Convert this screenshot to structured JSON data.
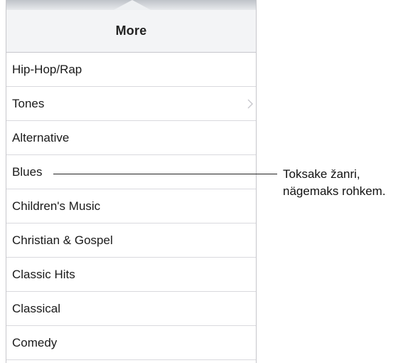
{
  "popover": {
    "title": "More",
    "items": [
      {
        "label": "Hip-Hop/Rap"
      },
      {
        "label": "Tones"
      },
      {
        "label": "Alternative"
      },
      {
        "label": "Blues"
      },
      {
        "label": "Children's Music"
      },
      {
        "label": "Christian & Gospel"
      },
      {
        "label": "Classic Hits"
      },
      {
        "label": "Classical"
      },
      {
        "label": "Comedy"
      }
    ]
  },
  "callout": {
    "line1": "Toksake žanri,",
    "line2": "nägemaks rohkem."
  },
  "icons": {
    "tones_row": "chevron-right-icon"
  },
  "colors": {
    "header_bg": "#f3f4f6",
    "separator": "#d9d9de",
    "text": "#1a1a1a",
    "chevron": "#c7c7cc"
  }
}
